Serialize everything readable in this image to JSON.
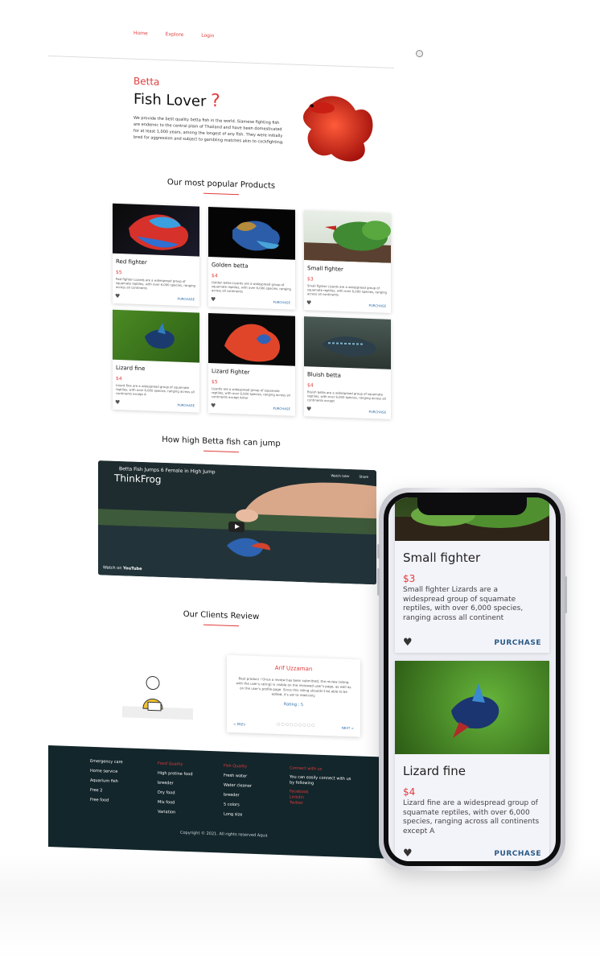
{
  "nav": {
    "links": [
      "Home",
      "Explore",
      "Login"
    ]
  },
  "hero": {
    "subtitle": "Betta",
    "title": "Fish Lover",
    "title_mark": "?",
    "description": "We provide the best quality betta fish in the world. Siamese fighting fish are endemic to the central plain of Thailand and have been domesticated for at least 1,000 years, among the longest of any fish. They were initially bred for aggression and subject to gambling matches akin to cockfighting."
  },
  "products_title": "Our most popular Products",
  "products": [
    {
      "name": "Red fighter",
      "price": "$5",
      "desc": "Red fighter Lizards are a widespread group of squamate reptiles, with over 6,000 species, ranging across all continents",
      "action": "PURCHASE"
    },
    {
      "name": "Golden betta",
      "price": "$4",
      "desc": "Golden betta Lizards are a widespread group of squamate reptiles, with over 6,000 species, ranging across all continents",
      "action": "PURCHASE"
    },
    {
      "name": "Small fighter",
      "price": "$3",
      "desc": "Small fighter Lizards are a widespread group of squamate reptiles, with over 6,000 species, ranging across all continents",
      "action": "PURCHASE"
    },
    {
      "name": "Lizard fine",
      "price": "$4",
      "desc": "Lizard fine are a widespread group of squamate reptiles, with over 6,000 species, ranging across all continents except A",
      "action": "PURCHASE"
    },
    {
      "name": "Lizard Fighter",
      "price": "$5",
      "desc": "Lizards are a widespread group of squamate reptiles, with over 6,000 species, ranging across all continents except Antar",
      "action": "PURCHASE"
    },
    {
      "name": "Bluish betta",
      "price": "$4",
      "desc": "Bluish betta are a widespread group of squamate reptiles, with over 6,000 species, ranging across all continents except",
      "action": "PURCHASE"
    }
  ],
  "video_title": "How high Betta fish can jump",
  "video": {
    "title": "Betta Fish Jumps 6 Female in High Jump",
    "brand": "ThinkFrog",
    "watch_on": "Watch on",
    "platform": "YouTube",
    "watch_later": "Watch later",
    "share": "Share"
  },
  "reviews_title": "Our Clients Review",
  "review": {
    "name": "Arif Uzzaman",
    "text": "Best product ! Once a review has been submitted, the review (along with the user's rating) is visible on the reviewed user's page, as well as on the user's profile page. Since this rating shouldn't be able to be edited, it's set to read-only.",
    "rating": "Rating : 5",
    "prev": "< PREV",
    "next": "NEXT >",
    "dots": "○○○○○○○○○"
  },
  "footer": {
    "col1": [
      "Emergency care",
      "Home service",
      "Aquarium fish",
      "Free 2",
      "Free food"
    ],
    "col2": {
      "heading": "Food Quality",
      "items": [
        "High protine food",
        "breeder",
        "Dry food",
        "Mix food",
        "Variation"
      ]
    },
    "col3": {
      "heading": "Fish Quality",
      "items": [
        "Fresh water",
        "Water cleaner",
        "breeder",
        "5 colors",
        "Long size"
      ]
    },
    "col4": {
      "heading": "Connect with us",
      "text": "You can easily connect with us by following",
      "links": [
        "Facebook",
        "Linkdin",
        "Twitter"
      ]
    },
    "copyright": "Copyright © 2021. All rights reserved Aqua"
  },
  "phone": {
    "cards": [
      {
        "name": "Small fighter",
        "price": "$3",
        "desc": "Small fighter Lizards are a widespread group of squamate reptiles, with over 6,000 species, ranging across all continent",
        "action": "PURCHASE"
      },
      {
        "name": "Lizard fine",
        "price": "$4",
        "desc": "Lizard fine are a widespread group of squamate reptiles, with over 6,000 species, ranging across all continents except A",
        "action": "PURCHASE"
      }
    ]
  },
  "colors": {
    "accent": "#e23b3b",
    "footer_bg": "#13262b",
    "link": "#2a6ca8"
  }
}
